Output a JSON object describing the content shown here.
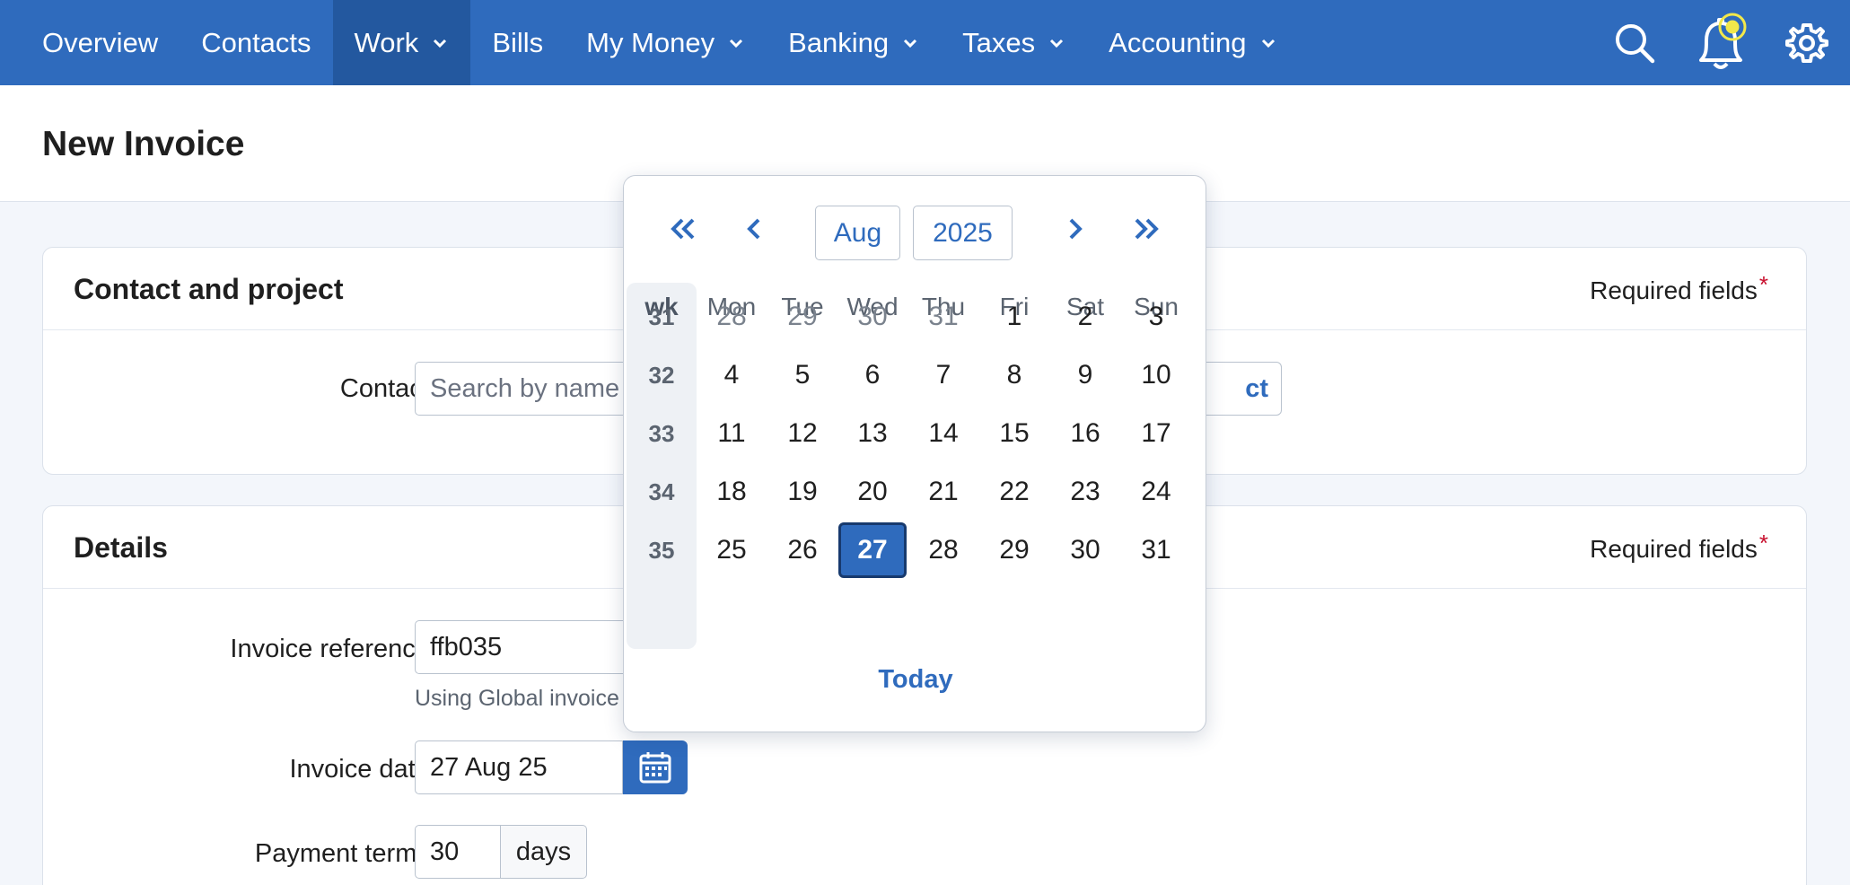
{
  "nav": {
    "items": [
      {
        "label": "Overview",
        "dropdown": false,
        "active": false
      },
      {
        "label": "Contacts",
        "dropdown": false,
        "active": false
      },
      {
        "label": "Work",
        "dropdown": true,
        "active": true
      },
      {
        "label": "Bills",
        "dropdown": false,
        "active": false
      },
      {
        "label": "My Money",
        "dropdown": true,
        "active": false
      },
      {
        "label": "Banking",
        "dropdown": true,
        "active": false
      },
      {
        "label": "Taxes",
        "dropdown": true,
        "active": false
      },
      {
        "label": "Accounting",
        "dropdown": true,
        "active": false
      }
    ],
    "icons": [
      "search-icon",
      "bell-icon",
      "gear-icon"
    ]
  },
  "page": {
    "title": "New Invoice"
  },
  "contact_card": {
    "title": "Contact and project",
    "required_note": "Required fields",
    "contact_label": "Contact",
    "contact_placeholder": "Search by name",
    "button_label_partial": "ct"
  },
  "details_card": {
    "title": "Details",
    "required_note": "Required fields",
    "invoice_reference_label": "Invoice reference",
    "invoice_reference_value": "ffb035",
    "invoice_reference_hint": "Using Global invoice",
    "invoice_date_label": "Invoice date",
    "invoice_date_value": "27 Aug 25",
    "payment_terms_label": "Payment terms",
    "payment_terms_value": "30",
    "payment_terms_unit": "days"
  },
  "datepicker": {
    "month": "Aug",
    "year": "2025",
    "week_header": "wk",
    "weekdays": [
      "Mon",
      "Tue",
      "Wed",
      "Thu",
      "Fri",
      "Sat",
      "Sun"
    ],
    "weeks": [
      {
        "wk": "31",
        "days": [
          {
            "d": "28",
            "muted": true
          },
          {
            "d": "29",
            "muted": true
          },
          {
            "d": "30",
            "muted": true
          },
          {
            "d": "31",
            "muted": true
          },
          {
            "d": "1"
          },
          {
            "d": "2"
          },
          {
            "d": "3"
          }
        ]
      },
      {
        "wk": "32",
        "days": [
          {
            "d": "4"
          },
          {
            "d": "5"
          },
          {
            "d": "6"
          },
          {
            "d": "7"
          },
          {
            "d": "8"
          },
          {
            "d": "9"
          },
          {
            "d": "10"
          }
        ]
      },
      {
        "wk": "33",
        "days": [
          {
            "d": "11"
          },
          {
            "d": "12"
          },
          {
            "d": "13"
          },
          {
            "d": "14"
          },
          {
            "d": "15"
          },
          {
            "d": "16"
          },
          {
            "d": "17"
          }
        ]
      },
      {
        "wk": "34",
        "days": [
          {
            "d": "18"
          },
          {
            "d": "19"
          },
          {
            "d": "20"
          },
          {
            "d": "21"
          },
          {
            "d": "22"
          },
          {
            "d": "23"
          },
          {
            "d": "24"
          }
        ]
      },
      {
        "wk": "35",
        "days": [
          {
            "d": "25"
          },
          {
            "d": "26"
          },
          {
            "d": "27",
            "selected": true
          },
          {
            "d": "28"
          },
          {
            "d": "29"
          },
          {
            "d": "30"
          },
          {
            "d": "31"
          }
        ]
      }
    ],
    "today_label": "Today"
  },
  "colors": {
    "brand": "#2f6bbd",
    "nav_active": "#23589f",
    "required": "#c8102e",
    "notification": "#f2e84b"
  }
}
